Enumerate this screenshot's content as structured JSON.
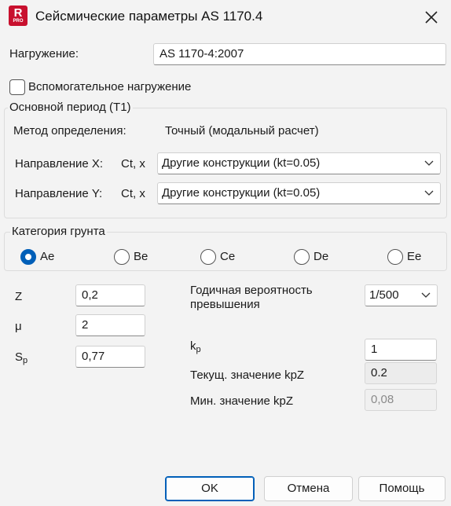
{
  "window": {
    "title": "Сейсмические параметры AS 1170.4",
    "icon_letter": "R",
    "icon_badge": "PRO"
  },
  "load_case": {
    "label": "Нагружение:",
    "value": "AS 1170-4:2007"
  },
  "auxiliary": {
    "label": "Вспомогательное нагружение",
    "checked": false
  },
  "period_group": {
    "title": "Основной период (T1)",
    "method_label": "Метод определения:",
    "method_value": "Точный (модальный расчет)",
    "dir_x_label": "Направление X:",
    "dir_x_param": "Ct, x",
    "dir_x_value": "Другие конструкции (kt=0.05)",
    "dir_y_label": "Направление Y:",
    "dir_y_param": "Ct, x",
    "dir_y_value": "Другие конструкции (kt=0.05)"
  },
  "soil_group": {
    "title": "Категория грунта",
    "options": [
      {
        "label": "Ae",
        "selected": true
      },
      {
        "label": "Be",
        "selected": false
      },
      {
        "label": "Ce",
        "selected": false
      },
      {
        "label": "De",
        "selected": false
      },
      {
        "label": "Ee",
        "selected": false
      }
    ]
  },
  "params": {
    "z_label": "Z",
    "z_value": "0,2",
    "mu_label": "μ",
    "mu_value": "2",
    "sp_label_main": "S",
    "sp_label_sub": "p",
    "sp_value": "0,77"
  },
  "probability": {
    "label": "Годичная вероятность превышения",
    "value": "1/500"
  },
  "kp": {
    "label_main": "k",
    "label_sub": "p",
    "value": "1"
  },
  "current_kpz": {
    "label": "Текущ. значение kpZ",
    "value": "0.2"
  },
  "min_kpz": {
    "label": "Мин. значение kpZ",
    "value": "0,08"
  },
  "buttons": {
    "ok": "OK",
    "cancel": "Отмена",
    "help": "Помощь"
  },
  "colors": {
    "accent": "#005fb8",
    "brand": "#c8102e"
  }
}
